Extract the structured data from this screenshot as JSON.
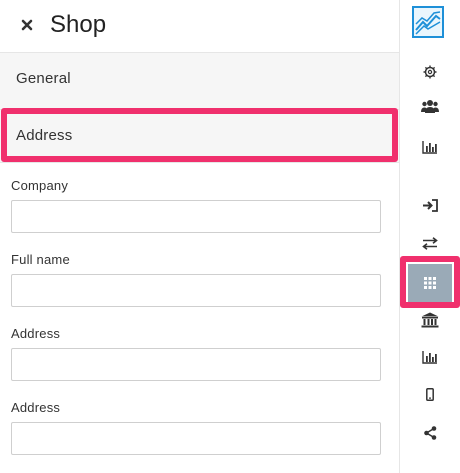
{
  "header": {
    "title": "Shop",
    "close_icon": "close-icon"
  },
  "sections": {
    "general": "General",
    "address": "Address"
  },
  "fields": [
    {
      "label": "Company",
      "value": "",
      "placeholder": ""
    },
    {
      "label": "Full name",
      "value": "",
      "placeholder": ""
    },
    {
      "label": "Address",
      "value": "",
      "placeholder": ""
    },
    {
      "label": "Address",
      "value": "",
      "placeholder": ""
    }
  ],
  "rail": {
    "items": [
      "chart-logo-icon",
      "gear-icon",
      "users-icon",
      "bar-chart-icon",
      "sign-in-icon",
      "exchange-icon",
      "grid-icon",
      "bank-icon",
      "bar-chart-icon",
      "mobile-icon",
      "share-icon"
    ],
    "active": "grid-icon"
  },
  "colors": {
    "highlight": "#f0306d",
    "accent": "#1e90d8",
    "active_bg": "#9aaab7"
  }
}
